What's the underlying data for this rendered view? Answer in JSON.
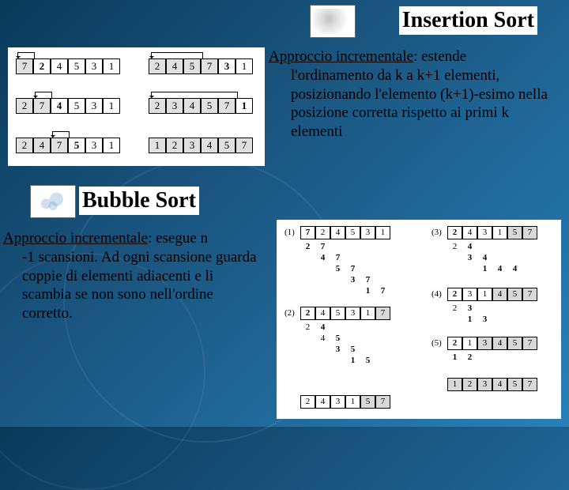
{
  "titles": {
    "insertion": "Insertion Sort",
    "bubble": "Bubble Sort"
  },
  "insertion_desc": {
    "lead": "Approccio incrementale",
    "rest": ": estende l'ordinamento da k a k+1 elementi, posizionando l'elemento (k+1)-esimo nella posizione corretta rispetto ai primi k elementi"
  },
  "bubble_desc": {
    "lead": "Approccio incrementale",
    "rest": ": esegue n -1 scansioni. Ad ogni scansione guarda coppie di elementi adiacenti e li scambia se non sono nell'ordine corretto."
  },
  "insertion_rows": {
    "r1a": [
      "7",
      "2",
      "4",
      "5",
      "3",
      "1"
    ],
    "r1b": [
      "2",
      "4",
      "5",
      "7",
      "3",
      "1"
    ],
    "r2a": [
      "2",
      "7",
      "4",
      "5",
      "3",
      "1"
    ],
    "r2b": [
      "2",
      "3",
      "4",
      "5",
      "7",
      "1"
    ],
    "r3a": [
      "2",
      "4",
      "7",
      "5",
      "3",
      "1"
    ],
    "r3b": [
      "1",
      "2",
      "3",
      "4",
      "5",
      "7"
    ]
  },
  "bubble": {
    "labels": {
      "l1": "(1)",
      "l2": "(2)",
      "l3": "(3)",
      "l4": "(4)",
      "l5": "(5)"
    },
    "seq1": [
      "7",
      "2",
      "4",
      "5",
      "3",
      "1"
    ],
    "pairs1": [
      [
        "2",
        "7"
      ],
      [
        "4",
        "7"
      ],
      [
        "5",
        "7"
      ],
      [
        "3",
        "7"
      ],
      [
        "1",
        "7"
      ]
    ],
    "seq2": [
      "2",
      "4",
      "5",
      "3",
      "1",
      "7"
    ],
    "pairs2": [
      [
        "2",
        "4"
      ],
      [
        "4",
        "5"
      ],
      [
        "3",
        "5"
      ],
      [
        "1",
        "5"
      ]
    ],
    "mid": [
      "2",
      "4",
      "3",
      "1",
      "5",
      "7"
    ],
    "seq3": [
      "2",
      "4",
      "3",
      "1",
      "5",
      "7"
    ],
    "pairs3": [
      [
        "2",
        "4"
      ],
      [
        "3",
        "4"
      ],
      [
        "1",
        "4"
      ],
      [
        "",
        "4"
      ]
    ],
    "seq4": [
      "2",
      "3",
      "1",
      "4",
      "5",
      "7"
    ],
    "pairs4": [
      [
        "2",
        "3"
      ],
      [
        "1",
        "3"
      ]
    ],
    "seq5": [
      "2",
      "1",
      "3",
      "4",
      "5",
      "7"
    ],
    "pairs5": [
      [
        "1",
        "2"
      ]
    ],
    "final": [
      "1",
      "2",
      "3",
      "4",
      "5",
      "7"
    ]
  }
}
